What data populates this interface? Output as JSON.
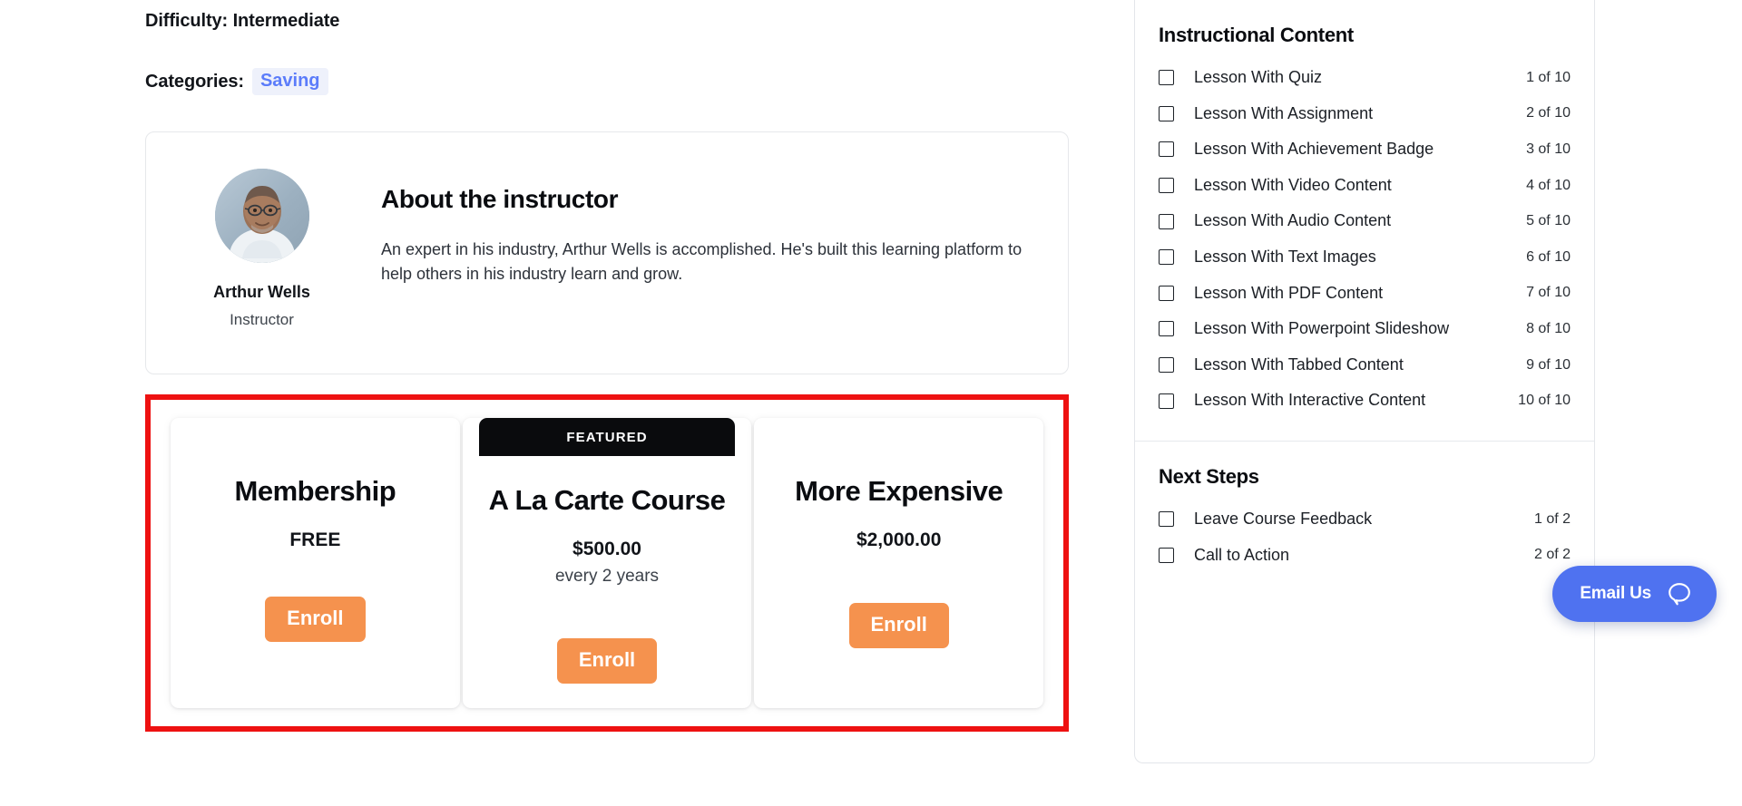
{
  "course_meta": {
    "difficulty_label": "Difficulty: Intermediate",
    "categories_label": "Categories:",
    "category_chip": "Saving",
    "chip_color": "#5b7cfa"
  },
  "instructor": {
    "avatar_icon": "instructor-photo",
    "name": "Arthur Wells",
    "role": "Instructor",
    "heading": "About the instructor",
    "bio": "An expert in his industry, Arthur Wells is accomplished. He's built this learning platform to help others in his industry learn and grow."
  },
  "pricing": {
    "highlight_color": "#ee1111",
    "enroll_color": "#f5924e",
    "cards": [
      {
        "title": "Membership",
        "price": "FREE",
        "sub": "",
        "badge": "",
        "enroll_label": "Enroll"
      },
      {
        "title": "A La Carte Course",
        "price": "$500.00",
        "sub": "every 2 years",
        "badge": "FEATURED",
        "enroll_label": "Enroll"
      },
      {
        "title": "More Expensive",
        "price": "$2,000.00",
        "sub": "",
        "badge": "",
        "enroll_label": "Enroll"
      }
    ]
  },
  "sidebar": {
    "instructional_content": {
      "title": "Instructional Content",
      "lessons": [
        {
          "label": "Lesson With Quiz",
          "count": "1 of 10"
        },
        {
          "label": "Lesson With Assignment",
          "count": "2 of 10"
        },
        {
          "label": "Lesson With Achievement Badge",
          "count": "3 of 10"
        },
        {
          "label": "Lesson With Video Content",
          "count": "4 of 10"
        },
        {
          "label": "Lesson With Audio Content",
          "count": "5 of 10"
        },
        {
          "label": "Lesson With Text Images",
          "count": "6 of 10"
        },
        {
          "label": "Lesson With PDF Content",
          "count": "7 of 10"
        },
        {
          "label": "Lesson With Powerpoint Slideshow",
          "count": "8 of 10"
        },
        {
          "label": "Lesson With Tabbed Content",
          "count": "9 of 10"
        },
        {
          "label": "Lesson With Interactive Content",
          "count": "10 of 10"
        }
      ]
    },
    "next_steps": {
      "title": "Next Steps",
      "lessons": [
        {
          "label": "Leave Course Feedback",
          "count": "1 of 2"
        },
        {
          "label": "Call to Action",
          "count": "2 of 2"
        }
      ]
    }
  },
  "support_widget": {
    "label": "Email Us",
    "icon": "chat-bubble-icon",
    "color": "#4f72f0"
  }
}
